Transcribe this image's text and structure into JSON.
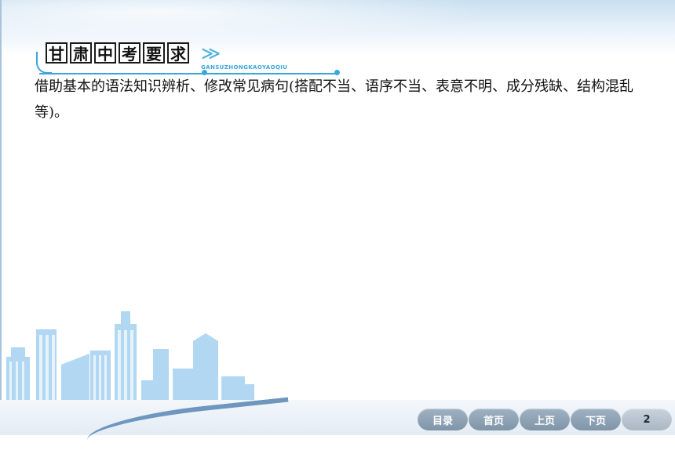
{
  "banner": {
    "chars": [
      "甘",
      "肃",
      "中",
      "考",
      "要",
      "求"
    ],
    "chevron": "≫",
    "subtitle": "GANSUZHONGKAOYAOQIU"
  },
  "content": {
    "text": "借助基本的语法知识辨析、修改常见病句(搭配不当、语序不当、表意不明、成分残缺、结构混乱等)。"
  },
  "nav": {
    "catalog": "目录",
    "home": "首页",
    "prev": "上页",
    "next": "下页",
    "page": "2"
  },
  "colors": {
    "accent": "#3aa6dd",
    "skyline": "#8ec5ec",
    "button": "#8ea3b5"
  }
}
